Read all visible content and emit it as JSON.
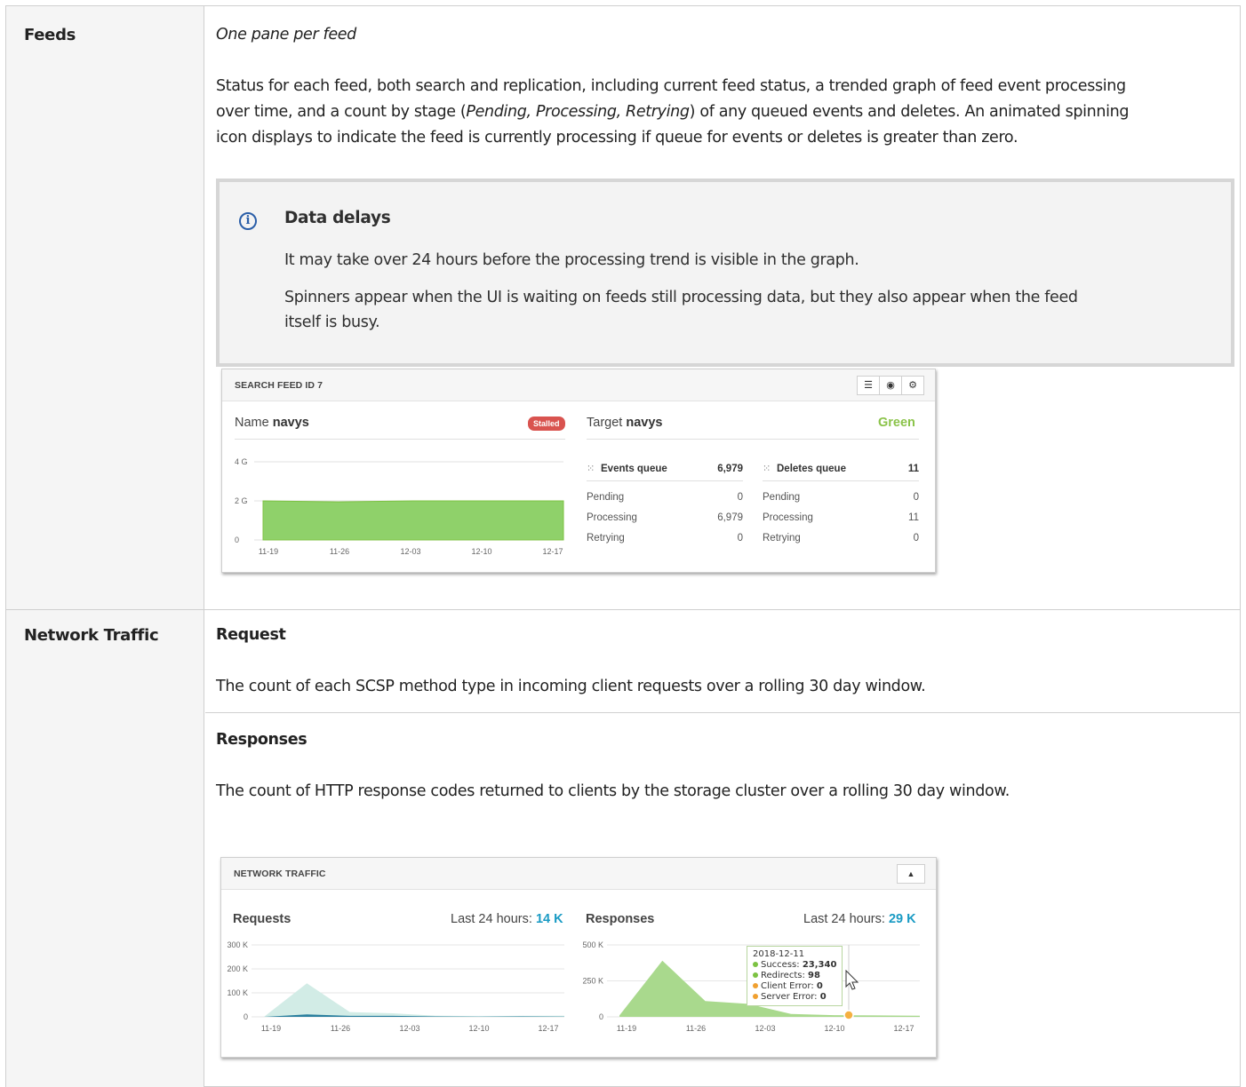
{
  "doc": {
    "feeds_label": "Feeds",
    "feeds_subtitle": "One pane per feed",
    "feeds_desc_1": "Status for each feed, both search and replication, including current feed status, a trended graph of feed event processing",
    "feeds_desc_2a": "over time, and a count by stage (",
    "feeds_desc_2b": "Pending, Processing, Retrying",
    "feeds_desc_2c": ") of any queued events and deletes. An animated spinning",
    "feeds_desc_3": "icon displays to indicate the feed is currently processing if queue for events or deletes is greater than zero.",
    "note": {
      "icon": "info-icon",
      "title": "Data delays",
      "p1": "It may take over 24 hours before the processing trend is visible in the graph.",
      "p2a": "Spinners appear when the UI is waiting on feeds still processing data, but they also appear when the feed",
      "p2b": "itself is busy."
    },
    "net_label": "Network Traffic",
    "request_title": "Request",
    "request_desc": "The count of each SCSP method type in incoming client requests over a rolling 30 day window.",
    "responses_title": "Responses",
    "responses_desc": "The count of HTTP response codes returned to clients by the storage cluster over a rolling 30 day window."
  },
  "feed_panel": {
    "title": "SEARCH FEED ID 7",
    "buttons": [
      {
        "icon": "list-icon",
        "glyph": "☰"
      },
      {
        "icon": "dashboard-icon",
        "glyph": "◉"
      },
      {
        "icon": "gear-icon",
        "glyph": "⚙"
      }
    ],
    "name_prefix": "Name",
    "name_value": "navys",
    "status_badge": "Stalled",
    "target_prefix": "Target",
    "target_value": "navys",
    "target_health": "Green",
    "events_queue_label": "Events queue",
    "events_queue_total": "6,979",
    "deletes_queue_label": "Deletes queue",
    "deletes_queue_total": "11",
    "events": [
      {
        "stage": "Pending",
        "value": "0"
      },
      {
        "stage": "Processing",
        "value": "6,979"
      },
      {
        "stage": "Retrying",
        "value": "0"
      }
    ],
    "deletes": [
      {
        "stage": "Pending",
        "value": "0"
      },
      {
        "stage": "Processing",
        "value": "11"
      },
      {
        "stage": "Retrying",
        "value": "0"
      }
    ]
  },
  "net_panel": {
    "title": "NETWORK TRAFFIC",
    "button_icon": "area-chart-icon",
    "button_glyph": "▲",
    "requests_title": "Requests",
    "requests_last_label": "Last 24 hours:",
    "requests_last_value": "14 K",
    "responses_title": "Responses",
    "responses_last_label": "Last 24 hours:",
    "responses_last_value": "29 K",
    "tooltip": {
      "date": "2018-12-11",
      "items": [
        {
          "label": "Success:",
          "value": "23,340",
          "color": "#7cc242"
        },
        {
          "label": "Redirects:",
          "value": "98",
          "color": "#7cc242"
        },
        {
          "label": "Client Error:",
          "value": "0",
          "color": "#f0a030"
        },
        {
          "label": "Server Error:",
          "value": "0",
          "color": "#f0a030"
        }
      ]
    }
  },
  "chart_data": [
    {
      "type": "area",
      "name": "feed-processing",
      "x": [
        "11-19",
        "11-26",
        "12-03",
        "12-10",
        "12-17"
      ],
      "yticks": [
        "4 G",
        "2 G",
        "0"
      ],
      "ylim": [
        0,
        4
      ],
      "values": [
        2.0,
        1.95,
        2.0,
        2.0,
        2.0
      ],
      "color": "#8fd16a"
    },
    {
      "type": "area",
      "name": "requests",
      "x": [
        "11-19",
        "11-26",
        "12-03",
        "12-10",
        "12-17"
      ],
      "yticks": [
        "300 K",
        "200 K",
        "100 K",
        "0"
      ],
      "ylim": [
        0,
        300
      ],
      "series_light": [
        0,
        140,
        20,
        15,
        5,
        3,
        4,
        5
      ],
      "series_dark": [
        0,
        10,
        4,
        4,
        2,
        1,
        2,
        1
      ],
      "colors": [
        "#d2ece6",
        "#2a7f9e"
      ]
    },
    {
      "type": "area",
      "name": "responses",
      "x": [
        "11-19",
        "11-26",
        "12-03",
        "12-10",
        "12-17"
      ],
      "yticks": [
        "500 K",
        "250 K",
        "0"
      ],
      "ylim": [
        0,
        500
      ],
      "values": [
        10,
        390,
        110,
        90,
        20,
        12,
        10,
        8
      ],
      "color": "#a9d98d"
    }
  ]
}
